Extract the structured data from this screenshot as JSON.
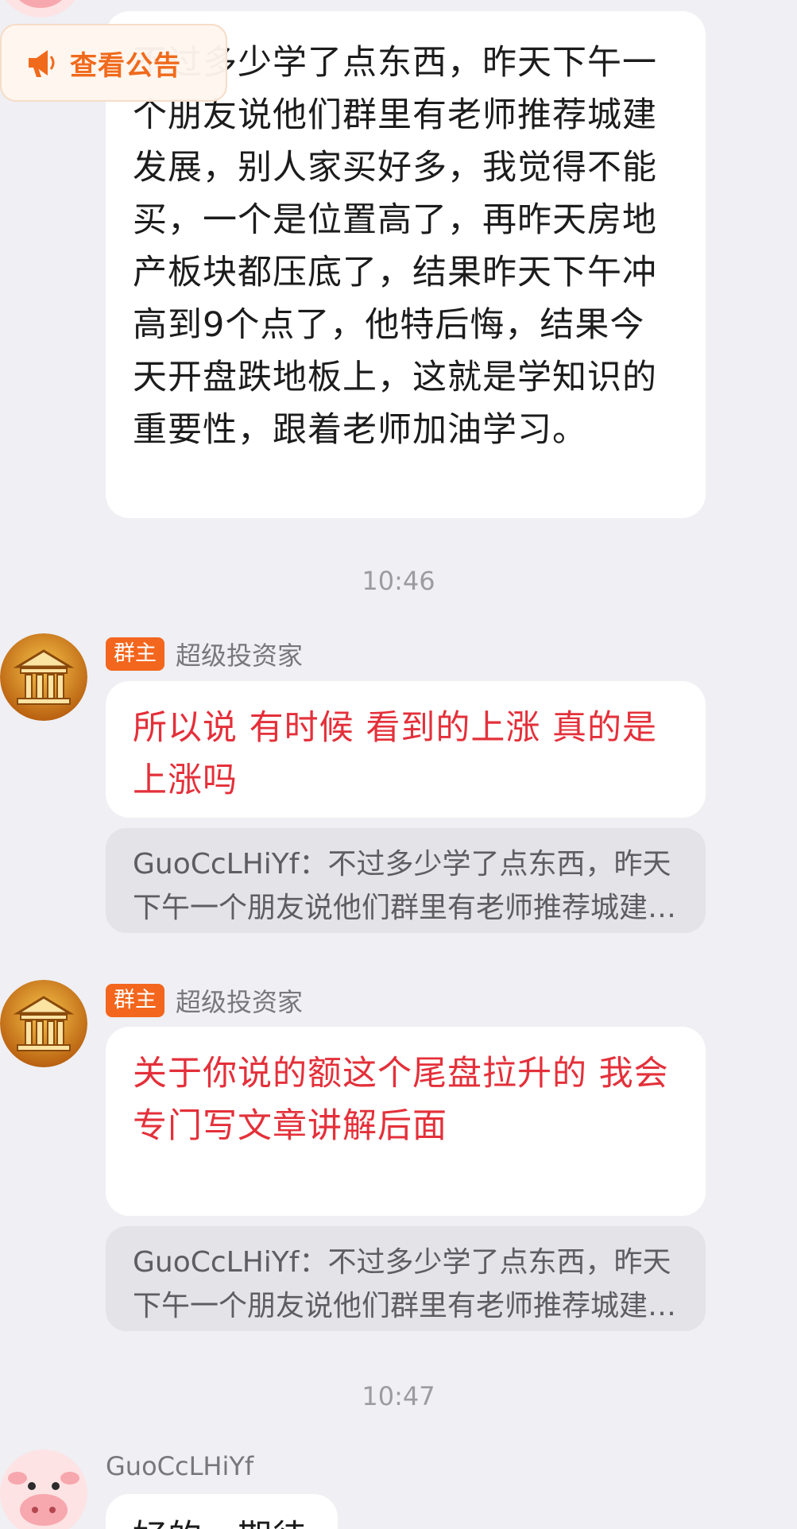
{
  "notice": {
    "label": "查看公告",
    "icon": "megaphone-icon",
    "color": "#f06a1c"
  },
  "messages": {
    "first": {
      "text": "不过多少学了点东西，昨天下午一个朋友说他们群里有老师推荐城建发展，别人家买好多，我觉得不能买，一个是位置高了，再昨天房地产板块都压底了，结果昨天下午冲高到9个点了，他特后悔，结果今天开盘跌地板上，这就是学知识的重要性，跟着老师加油学习。"
    },
    "time1": "10:46",
    "second": {
      "badge": "群主",
      "sender": "超级投资家",
      "text": "所以说 有时候 看到的上涨 真的是上涨吗",
      "quote": "GuoCcLHiYf：不过多少学了点东西，昨天下午一个朋友说他们群里有老师推荐城建发展，别人家买好多"
    },
    "third": {
      "badge": "群主",
      "sender": "超级投资家",
      "text": "关于你说的额这个尾盘拉升的 我会专门写文章讲解后面",
      "quote": "GuoCcLHiYf：不过多少学了点东西，昨天下午一个朋友说他们群里有老师推荐城建发展，别人家买好多"
    },
    "time2": "10:47",
    "fourth": {
      "sender": "GuoCcLHiYf",
      "text": "好的，期待"
    }
  },
  "colors": {
    "background": "#efeff4",
    "owner_badge": "#f3661d",
    "owner_text": "#e4303a"
  }
}
